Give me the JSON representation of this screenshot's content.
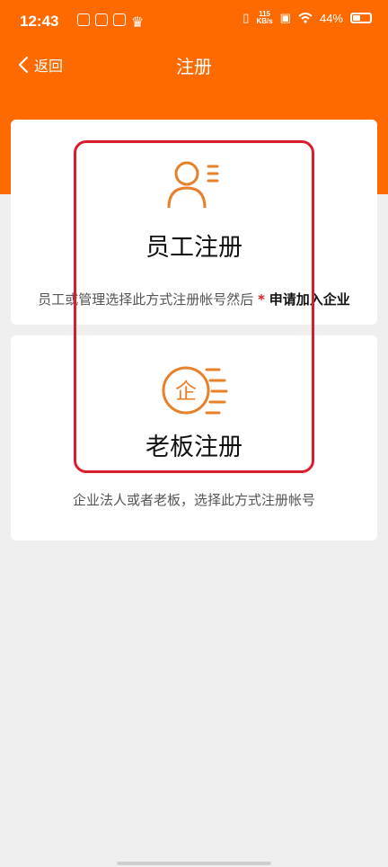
{
  "status_bar": {
    "time": "12:43",
    "speed_top": "115",
    "speed_bottom": "KB/s",
    "battery": "44%"
  },
  "nav": {
    "back_label": "返回",
    "title": "注册"
  },
  "cards": [
    {
      "title": "员工注册",
      "desc_text": "员工或管理选择此方式注册帐号然后",
      "desc_star": "*",
      "desc_strong": "申请加入企业",
      "icon": "person-icon"
    },
    {
      "title": "老板注册",
      "desc_text": "企业法人或者老板，选择此方式注册帐号",
      "icon": "enterprise-icon",
      "icon_char": "企"
    }
  ],
  "colors": {
    "brand": "#ff6a00",
    "highlight_box": "#d81e2c",
    "icon": "#e8802a"
  }
}
